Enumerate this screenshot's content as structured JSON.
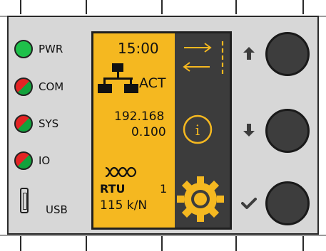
{
  "leds": [
    {
      "label": "PWR",
      "state": "on",
      "colors": [
        "#1ec04a"
      ]
    },
    {
      "label": "COM",
      "state": "mixed",
      "colors": [
        "#e32424",
        "#12a23c"
      ]
    },
    {
      "label": "SYS",
      "state": "mixed",
      "colors": [
        "#e32424",
        "#12a23c"
      ]
    },
    {
      "label": "IO",
      "state": "mixed",
      "colors": [
        "#e32424",
        "#12a23c"
      ]
    }
  ],
  "usb": {
    "label": "USB"
  },
  "display": {
    "time": "15:00",
    "network_status": "ACT",
    "ip_line1": "192.168",
    "ip_line2": "0.100",
    "protocol": "RTU",
    "address": "1",
    "baud": "115 k/N",
    "side_icons": [
      "tx-arrow-icon",
      "rx-arrow-icon",
      "info-icon",
      "gear-icon"
    ]
  },
  "buttons": [
    {
      "name": "up-button",
      "icon": "arrow-up-icon"
    },
    {
      "name": "down-button",
      "icon": "arrow-down-icon"
    },
    {
      "name": "ok-button",
      "icon": "checkmark-icon"
    }
  ],
  "colors": {
    "lcd": "#f5b820",
    "lcd_dark": "#3c3c3c",
    "panel": "#d7d7d7",
    "button": "#3d3d3d"
  }
}
